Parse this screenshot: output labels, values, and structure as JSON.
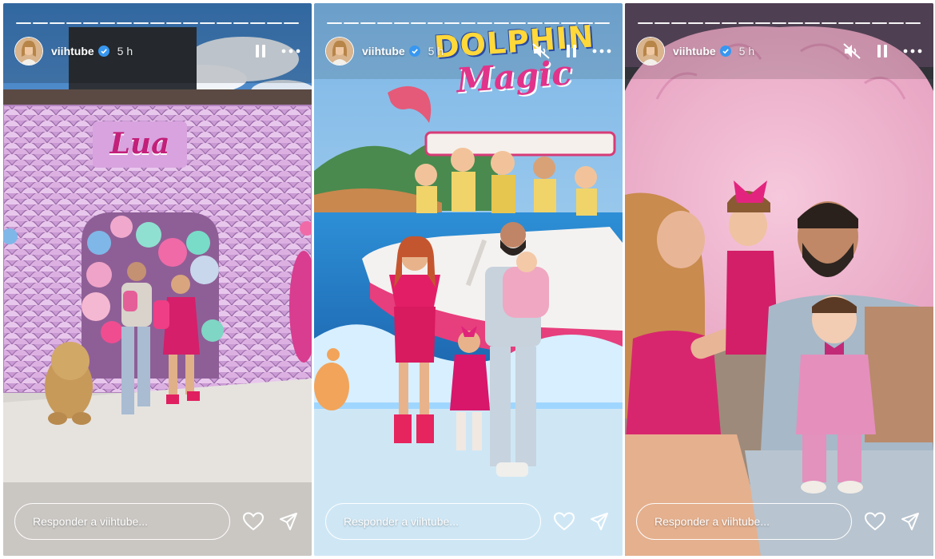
{
  "stories": [
    {
      "username": "viihtube",
      "time_ago": "5 h",
      "sign_text": "Lua",
      "reply_placeholder": "Responder a viihtube...",
      "progress_segments": 17,
      "show_mute": false
    },
    {
      "username": "viihtube",
      "time_ago": "5 h",
      "poster_text_1": "DOLPHIN",
      "poster_text_2": "Magic",
      "reply_placeholder": "Responder a viihtube...",
      "progress_segments": 17,
      "show_mute": true
    },
    {
      "username": "viihtube",
      "time_ago": "5 h",
      "reply_placeholder": "Responder a viihtube...",
      "progress_segments": 17,
      "show_mute": true
    }
  ],
  "colors": {
    "verified_badge": "#3897f0",
    "ui_white": "#ffffff",
    "theme_pink": "#e0338f"
  },
  "icons": [
    "verified-icon",
    "mute-icon",
    "pause-icon",
    "more-options-icon",
    "heart-icon",
    "send-icon"
  ]
}
